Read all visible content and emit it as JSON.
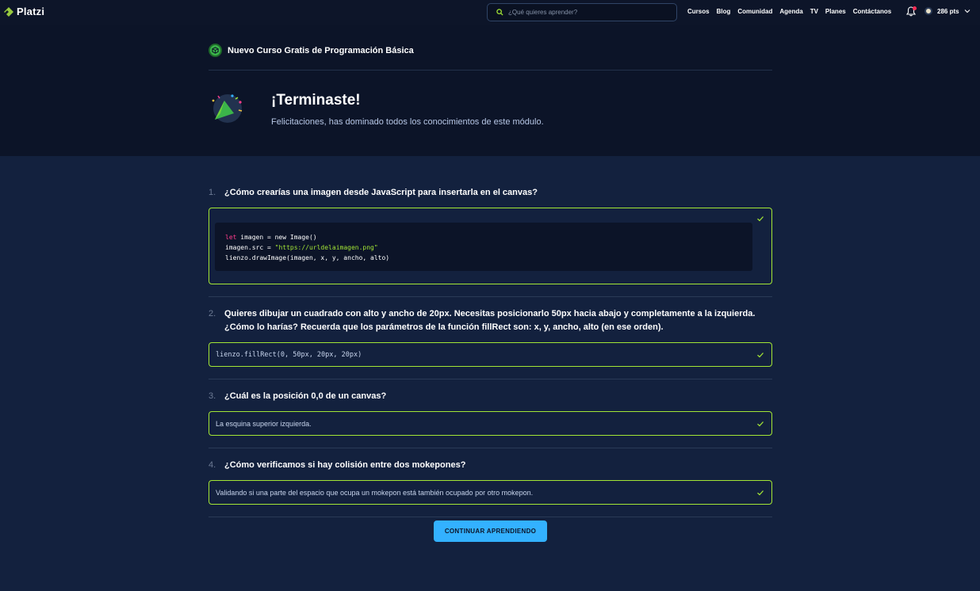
{
  "nav": {
    "logo_text": "Platzi",
    "search_placeholder": "¿Qué quieres aprender?",
    "links": [
      "Cursos",
      "Blog",
      "Comunidad",
      "Agenda",
      "TV",
      "Planes",
      "Contáctanos"
    ],
    "points": "286 pts"
  },
  "header": {
    "course_title": "Nuevo Curso Gratis de Programación Básica",
    "congrats_title": "¡Terminaste!",
    "congrats_subtitle": "Felicitaciones, has dominado todos los conocimientos de este módulo."
  },
  "questions": [
    {
      "number": "1.",
      "text": "¿Cómo crearías una imagen desde JavaScript para insertarla en el canvas?",
      "code_lines": [
        {
          "kw": "let",
          "rest": " imagen = new Image()"
        },
        {
          "pre": "imagen.src = ",
          "str": "\"https://urldelaimagen.png\""
        },
        {
          "plain": "lienzo.drawImage(imagen, x, y, ancho, alto)"
        }
      ]
    },
    {
      "number": "2.",
      "text": "Quieres dibujar un cuadrado con alto y ancho de 20px. Necesitas posicionarlo 50px hacia abajo y completamente a la izquierda.",
      "text_line2": "¿Cómo lo harías? Recuerda que los parámetros de la función fillRect son: x, y, ancho, alto (en ese orden).",
      "answer": "lienzo.fillRect(0, 50px, 20px, 20px)"
    },
    {
      "number": "3.",
      "text": "¿Cuál es la posición 0,0 de un canvas?",
      "answer": "La esquina superior izquierda."
    },
    {
      "number": "4.",
      "text": "¿Cómo verificamos si hay colisión entre dos mokepones?",
      "answer": "Validando si una parte del espacio que ocupa un mokepon está también ocupado por otro mokepon."
    }
  ],
  "cta_label": "CONTINUAR APRENDIENDO",
  "colors": {
    "accent_green": "#a3e635",
    "cta_blue": "#33b1ff",
    "notification_red": "#ff2d55"
  }
}
